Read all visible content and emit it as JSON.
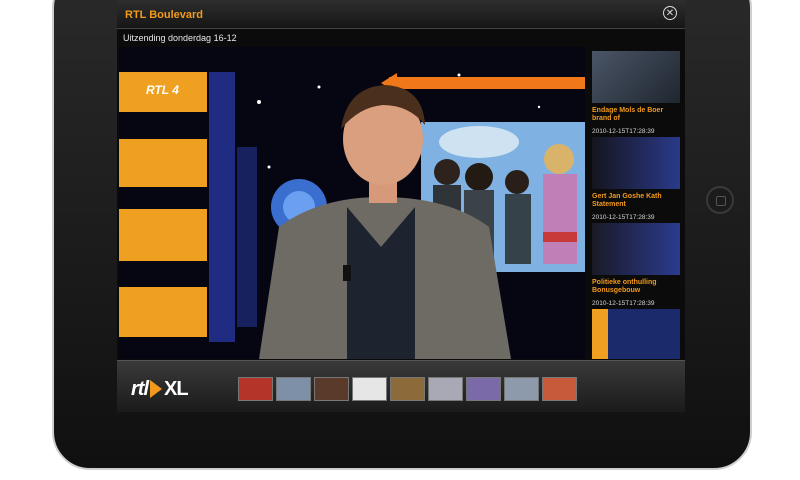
{
  "app": {
    "title": "RTL Boulevard",
    "close_icon": "close-circle-icon",
    "broadcast_text": "Uitzending donderdag 16-12"
  },
  "video": {
    "channel_logo": "RTL 4"
  },
  "sidebar": {
    "items": [
      {
        "caption": "Endage Mols de Boer brand of",
        "date": "2010-12-15T17:28:39"
      },
      {
        "caption": "Gert Jan Goshe Kath Statement",
        "date": "2010-12-15T17:28:39"
      },
      {
        "caption": "Politieke onthulling Bonusgebouw",
        "date": "2010-12-15T17:28:39"
      },
      {
        "caption": "",
        "date": ""
      }
    ]
  },
  "footer": {
    "logo_rtl": "rtl",
    "logo_xl": "XL",
    "thumbnails": [
      {
        "label": "thumb-1",
        "color": "#b5342a"
      },
      {
        "label": "thumb-2",
        "color": "#7e8fa8"
      },
      {
        "label": "thumb-3",
        "color": "#5a3a2a"
      },
      {
        "label": "thumb-4",
        "color": "#e6e6e6"
      },
      {
        "label": "thumb-5",
        "color": "#8c6a3a"
      },
      {
        "label": "thumb-6",
        "color": "#a9a9b6"
      },
      {
        "label": "thumb-7",
        "color": "#7a6aa8"
      },
      {
        "label": "thumb-8",
        "color": "#8c9aac"
      },
      {
        "label": "thumb-9",
        "color": "#c85a3c"
      }
    ]
  },
  "colors": {
    "accent": "#f39a1c",
    "bezel": "#111111"
  }
}
